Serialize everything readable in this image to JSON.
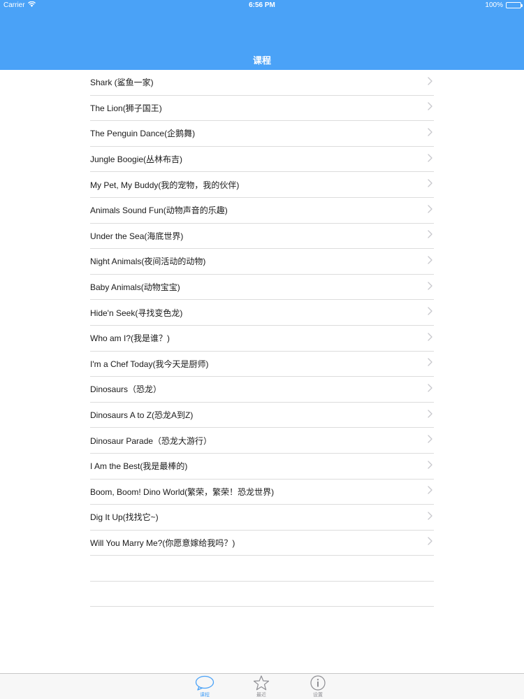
{
  "status_bar": {
    "carrier": "Carrier",
    "time": "6:56 PM",
    "battery": "100%"
  },
  "nav": {
    "title": "课程"
  },
  "colors": {
    "accent": "#4aa2f7",
    "separator": "#dcdcdc",
    "tab_inactive": "#8e8e93"
  },
  "courses": [
    "Shark (鲨鱼一家)",
    "The Lion(狮子国王)",
    "The Penguin Dance(企鹅舞)",
    "Jungle Boogie(丛林布吉)",
    "My Pet, My Buddy(我的宠物，我的伙伴)",
    "Animals Sound Fun(动物声音的乐趣)",
    "Under the Sea(海底世界)",
    "Night Animals(夜间活动的动物)",
    "Baby Animals(动物宝宝)",
    "Hide'n Seek(寻找变色龙)",
    "Who am I?(我是谁？)",
    "I'm a Chef Today(我今天是厨师)",
    "Dinosaurs（恐龙）",
    "Dinosaurs A to Z(恐龙A到Z)",
    "Dinosaur Parade（恐龙大游行）",
    "I Am the Best(我是最棒的)",
    "Boom, Boom! Dino World(繁荣，繁荣！恐龙世界)",
    "Dig It Up(找找它~)",
    "Will You Marry Me?(你愿意嫁给我吗？)"
  ],
  "tabs": [
    {
      "label": "课程",
      "icon": "chat-bubble-icon",
      "active": true
    },
    {
      "label": "最近",
      "icon": "star-icon",
      "active": false
    },
    {
      "label": "设置",
      "icon": "info-icon",
      "active": false
    }
  ]
}
